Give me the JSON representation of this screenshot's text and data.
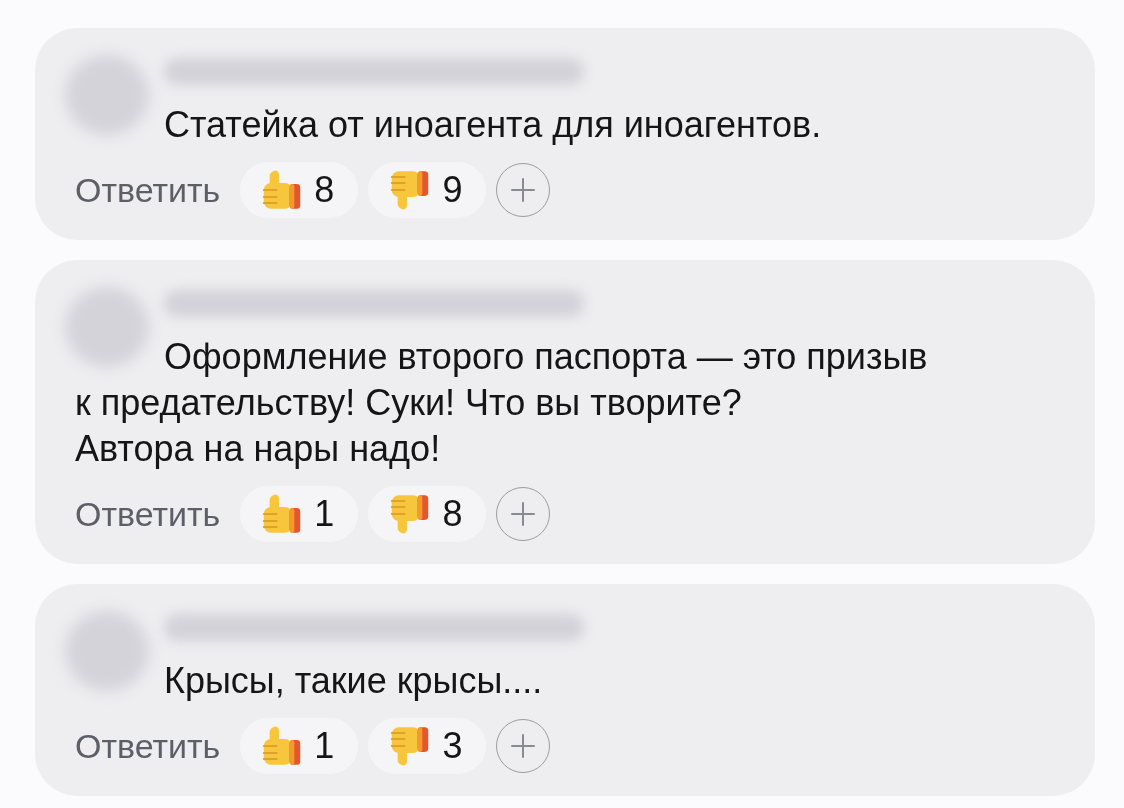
{
  "comments": [
    {
      "text": "Статейка от иноагента для иноагентов.",
      "reply_label": "Ответить",
      "reactions": [
        {
          "kind": "like",
          "count": "8"
        },
        {
          "kind": "dislike",
          "count": "9"
        }
      ]
    },
    {
      "text": "Оформление второго паспорта — это призыв к предательству! Суки! Что вы творите?\nАвтора на нары надо!",
      "reply_label": "Ответить",
      "reactions": [
        {
          "kind": "like",
          "count": "1"
        },
        {
          "kind": "dislike",
          "count": "8"
        }
      ]
    },
    {
      "text": "Крысы, такие крысы....",
      "reply_label": "Ответить",
      "reactions": [
        {
          "kind": "like",
          "count": "1"
        },
        {
          "kind": "dislike",
          "count": "3"
        }
      ]
    }
  ]
}
